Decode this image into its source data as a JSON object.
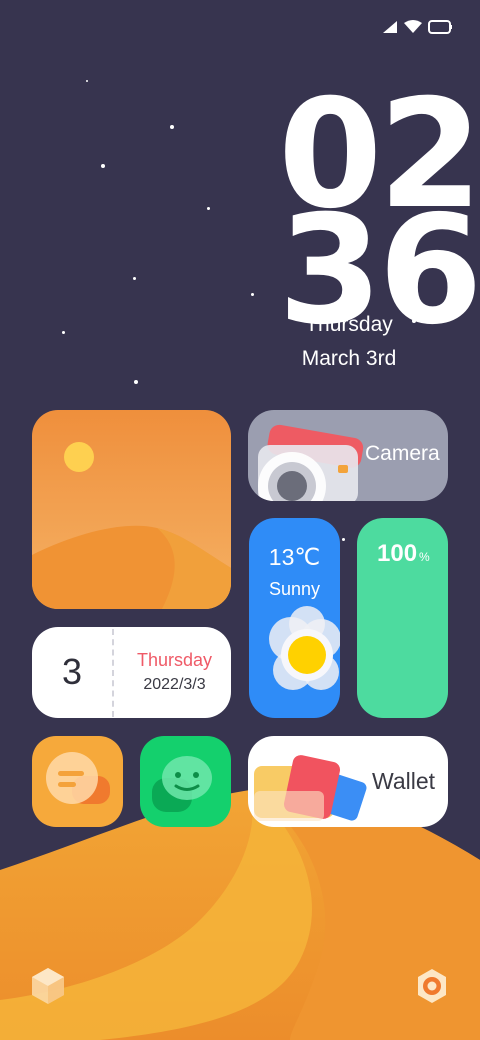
{
  "clock": {
    "hour": "02",
    "minute": "36",
    "weekday": "Thursday",
    "date": "March 3rd"
  },
  "widgets": {
    "camera": {
      "label": "Camera"
    },
    "weather": {
      "temperature": "13℃",
      "condition": "Sunny"
    },
    "battery": {
      "value": "100",
      "unit": "%"
    },
    "calendar": {
      "day": "3",
      "weekday": "Thursday",
      "date": "2022/3/3"
    },
    "wallet": {
      "label": "Wallet"
    }
  },
  "apps": [
    {
      "name": "messages",
      "icon": "chat-bubbles-icon"
    },
    {
      "name": "wechat",
      "icon": "wechat-icon"
    }
  ],
  "dock": [
    {
      "icon": "cube-icon"
    },
    {
      "icon": "settings-ring-icon"
    }
  ],
  "colors": {
    "wallpaper": "#37344f",
    "weather_bg": "#2f8cf7",
    "battery_bg": "#4ddb9f",
    "calendar_accent": "#ef5a67",
    "desert": "#f0a22e"
  }
}
